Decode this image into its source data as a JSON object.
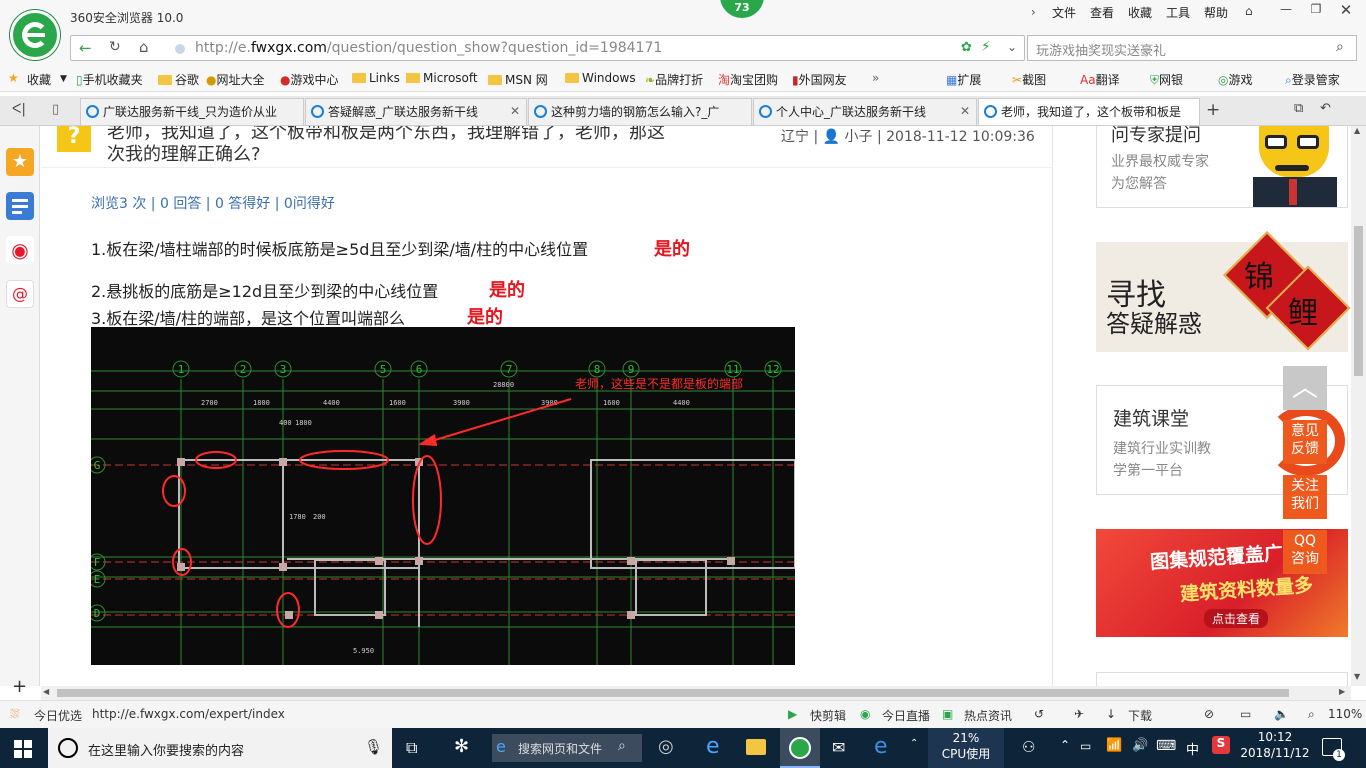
{
  "browser": {
    "title": "360安全浏览器 10.0",
    "badge": "73",
    "menu": [
      "文件",
      "查看",
      "收藏",
      "工具",
      "帮助"
    ],
    "url_prefix": "http://e.",
    "url_domain": "fwxgx.com",
    "url_path": "/question/question_show?question_id=1984171",
    "search_placeholder": "玩游戏抽奖现实送豪礼"
  },
  "favorites": {
    "left": [
      "收藏",
      "手机收藏夹",
      "谷歌",
      "网址大全",
      "游戏中心",
      "Links",
      "Microsoft",
      "MSN 网",
      "Windows",
      "品牌打折",
      "淘宝团购",
      "外国网友"
    ],
    "more": "»",
    "right": [
      "扩展",
      "截图",
      "翻译",
      "网银",
      "游戏",
      "登录管家"
    ]
  },
  "tabs": [
    {
      "label": "广联达服务新干线_只为造价从业"
    },
    {
      "label": "答疑解惑_广联达服务新干线"
    },
    {
      "label": "这种剪力墙的钢筋怎么输入?_广"
    },
    {
      "label": "个人中心_广联达服务新干线"
    },
    {
      "label": "老师，我知道了，这个板带和板是"
    }
  ],
  "question": {
    "title_line1": "老师，我知道了，这个板带和板是两个东西，我理解错了，老师，那这",
    "title_line2": "次我的理解正确么?",
    "region": "辽宁",
    "user": "小子",
    "datetime": "2018-11-12 10:09:36",
    "stats": "浏览3 次 | 0 回答 | 0 答得好 | 0问得好",
    "lines": [
      {
        "text": "1.板在梁/墙柱端部的时候板底筋是≥5d且至少到梁/墙/柱的中心线位置",
        "answer": "是的"
      },
      {
        "text": "2.悬挑板的底筋是≥12d且至少到梁的中心线位置",
        "answer": "是的"
      },
      {
        "text": "3.板在梁/墙/柱的端部，是这个位置叫端部么",
        "answer": "是的"
      }
    ]
  },
  "drawing": {
    "annotation": "老师，这些是不是都是板的端部",
    "axes_top": [
      "1",
      "2",
      "3",
      "5",
      "6",
      "7",
      "8",
      "9",
      "11",
      "12"
    ],
    "axes_left": [
      "G",
      "F",
      "E",
      "D"
    ],
    "dims": [
      "2700",
      "1800",
      "4400",
      "1600",
      "3900",
      "3900",
      "1600",
      "4400",
      "28800",
      "400",
      "1800",
      "1780",
      "200",
      "5.950"
    ]
  },
  "right_panel": {
    "card1_title": "问专家提问",
    "card1_sub1": "业界最权威专家",
    "card1_sub2": "为您解答",
    "banner1_a": "寻找",
    "banner1_b": "答疑解惑",
    "banner1_c1": "锦",
    "banner1_c2": "鲤",
    "card2_title": "建筑课堂",
    "card2_sub1": "建筑行业实训教",
    "card2_sub2": "学第一平台",
    "banner2_a": "图集规范覆盖广",
    "banner2_b": "建筑资料数量多",
    "banner2_c": "点击查看"
  },
  "float_buttons": {
    "feedback": "意见反馈",
    "follow": "关注我们",
    "qq": "QQ咨询"
  },
  "statusbar": {
    "left_label": "今日优选",
    "url": "http://e.fwxgx.com/expert/index",
    "items": [
      "快剪辑",
      "今日直播",
      "热点资讯",
      "下载"
    ],
    "zoom": "110%"
  },
  "taskbar": {
    "search_placeholder": "在这里输入你要搜索的内容",
    "browser_search": "搜索网页和文件",
    "cpu_percent": "21%",
    "cpu_label": "CPU使用",
    "ime": "中",
    "time": "10:12",
    "date": "2018/11/12",
    "notify_count": "1"
  },
  "colors": {
    "accent_green": "#2aa74a",
    "answer_red": "#e4161e",
    "float_orange": "#ee5a1e",
    "taskbar": "#0e2438",
    "cad_bg": "#0b0b0b"
  }
}
